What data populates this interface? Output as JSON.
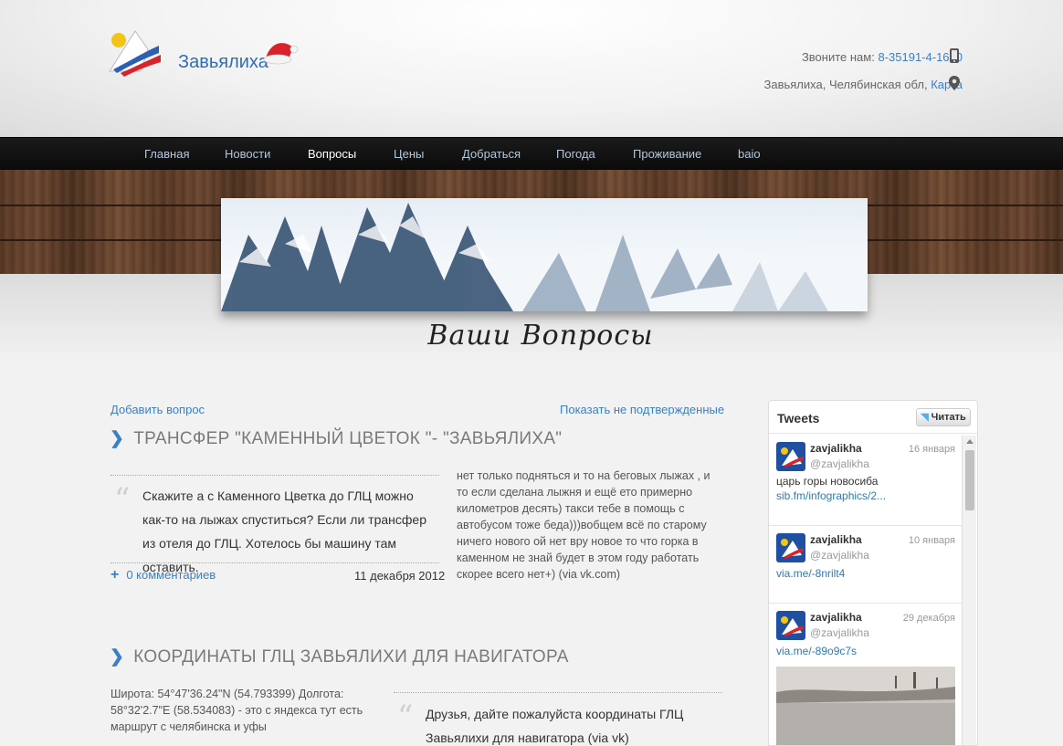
{
  "header": {
    "site_name": "Завьялиха",
    "phone_label": "Звоните нам:",
    "phone_number": "8-35191-4-1650",
    "address": "Завьялиха, Челябинская обл,",
    "map_link": "Карта"
  },
  "nav": {
    "items": [
      {
        "label": "Главная"
      },
      {
        "label": "Новости"
      },
      {
        "label": "Вопросы",
        "active": true
      },
      {
        "label": "Цены"
      },
      {
        "label": "Добраться"
      },
      {
        "label": "Погода"
      },
      {
        "label": "Проживание"
      },
      {
        "label": "baio"
      }
    ]
  },
  "page": {
    "title": "Ваши Вопросы",
    "add_question": "Добавить вопрос",
    "show_unconfirmed": "Показать не подтвержденные"
  },
  "questions": [
    {
      "title": "ТРАНСФЕР \"КАМЕННЫЙ ЦВЕТОК \"- \"ЗАВЬЯЛИХА\"",
      "text": "Скажите а с Каменного Цветка до ГЛЦ можно как-то на лыжах спуститься? Если ли трансфер из отеля до ГЛЦ. Хотелось бы машину там оставить.",
      "comments": "0 комментариев",
      "date": "11 декабря 2012",
      "answer": "нет только подняться и то на беговых лыжах , и то если сделана лыжня и ещё ето примерно километров десять) такси тебе в помощь с автобусом тоже беда)))вобщем всё по старому ничего нового ой нет вру новое то что горка в каменном не знай будет в этом году работать скорее всего нет+) (via vk.com)"
    },
    {
      "title": "КООРДИНАТЫ ГЛЦ ЗАВЬЯЛИХИ ДЛЯ НАВИГАТОРА",
      "answer": "Широта: 54°47'36.24\"N (54.793399) Долгота: 58°32'2.7\"E (58.534083) - это с яндекса тут есть маршрут с челябинска и уфы",
      "text": "Друзья, дайте пожалуйста координаты ГЛЦ Завьялихи для навигатора (via vk)"
    }
  ],
  "twitter": {
    "title": "Tweets",
    "follow_label": "Читать",
    "tweets": [
      {
        "name": "zavjalikha",
        "handle": "@zavjalikha",
        "time": "16 января",
        "text": "царь горы новосиба",
        "link": "sib.fm/infographics/2..."
      },
      {
        "name": "zavjalikha",
        "handle": "@zavjalikha",
        "time": "10 января",
        "text": "",
        "link": "via.me/-8nrilt4"
      },
      {
        "name": "zavjalikha",
        "handle": "@zavjalikha",
        "time": "29 декабря",
        "text": "",
        "link": "via.me/-89o9c7s"
      }
    ]
  },
  "colors": {
    "link": "#3c7fc4",
    "nav_bg": "#111111",
    "nav_text": "#b5c7d9",
    "twitter_link": "#2b7bb9"
  }
}
